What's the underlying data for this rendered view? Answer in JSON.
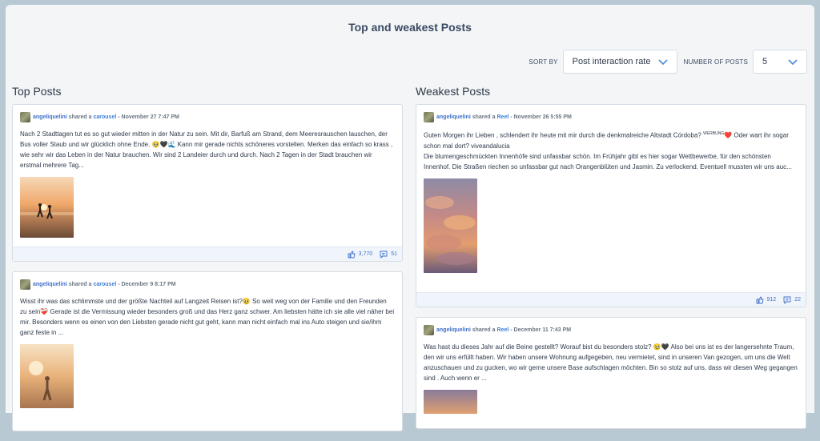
{
  "page": {
    "title": "Top and weakest Posts"
  },
  "controls": {
    "sort_label": "SORT BY",
    "sort_value": "Post interaction rate",
    "number_label": "NUMBER OF POSTS",
    "number_value": "5"
  },
  "top": {
    "heading": "Top Posts",
    "posts": [
      {
        "user": "angeliquelini",
        "shared": "shared a",
        "type": "carousel",
        "date": "- November 27 7:47 PM",
        "text": "Nach 2 Stadttagen tut es so gut wieder mitten in der Natur zu sein. Mit dir, Barfuß am Strand, dem Meeresrauschen lauschen, der Bus voller Staub und wir glücklich ohne Ende. 🥹🖤🌊 Kann mir gerade nichts schöneres vorstellen. Merken das einfach so krass , wie sehr wir das Leben in der Natur brauchen. Wir sind 2 Landeier durch und durch. Nach 2 Tagen in der Stadt brauchen wir erstmal mehrere Tag...",
        "likes": "3,770",
        "comments": "51"
      },
      {
        "user": "angeliquelini",
        "shared": "shared a",
        "type": "carousel",
        "date": "- December 9 8:17 PM",
        "text": "Wisst ihr was das schlimmste und der größte Nachteil auf Langzeit Reisen ist?🥹 So weit weg von der Familie und den Freunden zu sein❤️‍🩹 Gerade ist die Vermissung wieder besonders groß und das Herz ganz schwer. Am liebsten hätte ich sie alle viel näher bei mir. Besonders wenn es einen von den Liebsten gerade nicht gut geht, kann man nicht einfach mal ins Auto steigen und sie/ihm ganz feste in ..."
      }
    ]
  },
  "weak": {
    "heading": "Weakest Posts",
    "posts": [
      {
        "user": "angeliquelini",
        "shared": "shared a",
        "type": "Reel",
        "date": "- November 26 5:55 PM",
        "text_a": "Guten Morgen ihr Lieben , schlendert ihr heute mit mir durch die denkmalreiche Altstadt Córdoba?",
        "text_sup": "WERBUNG",
        "text_b": "❤️ Oder wart ihr sogar schon mal dort? viveandalucia",
        "text_c": "Die blumengeschmückten Innenhöfe sind unfassbar schön. Im Frühjahr gibt es hier sogar Wettbewerbe, für den schönsten Innenhof. Die Straßen riechen so unfassbar gut nach Orangenblüten und Jasmin. Zu verlockend. Eventuell mussten wir uns auc...",
        "likes": "912",
        "comments": "22"
      },
      {
        "user": "angeliquelini",
        "shared": "shared a",
        "type": "Reel",
        "date": "- December 11 7:43 PM",
        "text": "Was hast du dieses Jahr auf die Beine gestellt? Worauf bist du besonders stolz? 🥹🖤 Also bei uns ist es der langersehnte Traum, den wir uns erfüllt haben. Wir haben unsere Wohnung aufgegeben, neu vermietet, sind in unseren Van gezogen, um uns die Welt anzuschauen und zu gucken, wo wir gerne unsere Base aufschlagen möchten. Bin so stolz auf uns, dass wir diesen Weg gegangen sind . Auch wenn er ..."
      }
    ]
  }
}
